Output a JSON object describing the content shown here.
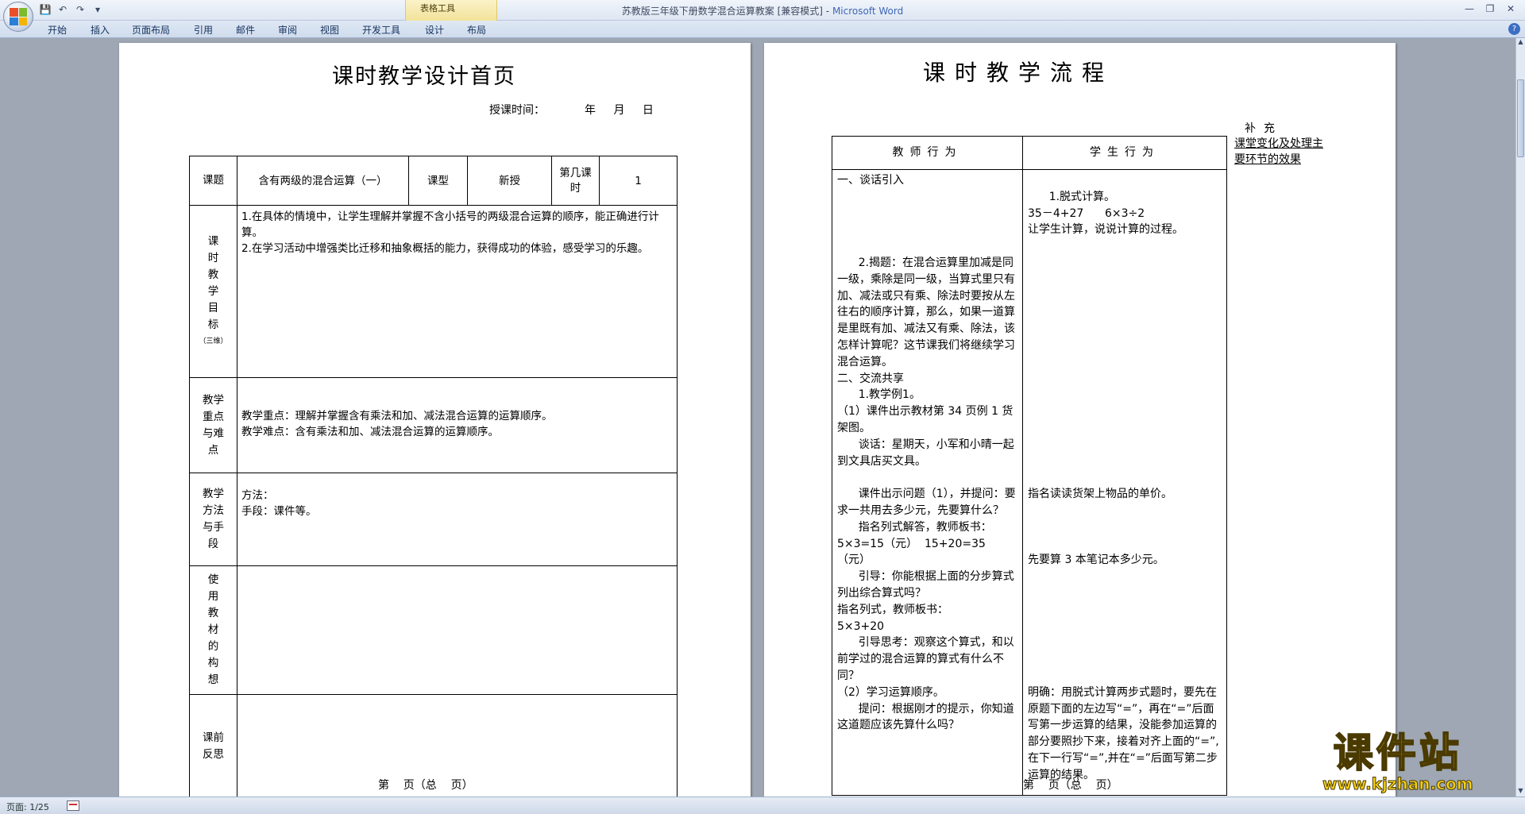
{
  "window": {
    "title": "苏教版三年级下册数学混合运算教案 [兼容模式]",
    "app": "Microsoft Word",
    "title_sep": " - ",
    "context_tab_group": "表格工具"
  },
  "qat": [
    "save",
    "undo",
    "redo",
    "customize"
  ],
  "tabs": [
    "开始",
    "插入",
    "页面布局",
    "引用",
    "邮件",
    "审阅",
    "视图",
    "开发工具",
    "设计",
    "布局"
  ],
  "page1": {
    "title": "课时教学设计首页",
    "time_label": "授课时间：",
    "time_fields": "年 月 日",
    "table": {
      "topic_label": "课题",
      "topic_value": "含有两级的混合运算（一）",
      "type_label": "课型",
      "type_value": "新授",
      "lesson_no_label": "第几课时",
      "lesson_no_value": "1",
      "goal_label": "课时教学目标",
      "goal_note": "（三维）",
      "goal_1": "1.在具体的情境中，让学生理解并掌握不含小括号的两级混合运算的顺序，能正确进行计算。",
      "goal_2": "2.在学习活动中增强类比迁移和抽象概括的能力，获得成功的体验，感受学习的乐趣。",
      "key_label": "教学重点与难点",
      "key_point": "教学重点：理解并掌握含有乘法和加、减法混合运算的运算顺序。",
      "difficulty": "教学难点：含有乘法和加、减法混合运算的运算顺序。",
      "method_label": "教学方法与手段",
      "method": "方法：",
      "means": "手段：课件等。",
      "material_label": "使用教材的构想",
      "reflect_label": "课前反思"
    },
    "footer": "第    页（总    页）"
  },
  "page2": {
    "title": "课时教学流程",
    "supp_title": "补充",
    "supp_link": "课堂变化及处理主要环节的效果",
    "col_teacher": "教师行为",
    "col_student": "学生行为",
    "teacher_text": "一、谈话引入\n\n\n\n\n      2.揭题：在混合运算里加减是同一级，乘除是同一级，当算式里只有加、减法或只有乘、除法时要按从左往右的顺序计算，那么，如果一道算是里既有加、减法又有乘、除法，该怎样计算呢？这节课我们将继续学习混合运算。\n二、交流共享\n      1.教学例1。\n（1）课件出示教材第 34 页例 1 货架图。\n      谈话：星期天，小军和小晴一起到文具店买文具。\n\n      课件出示问题（1），并提问：要求一共用去多少元，先要算什么？\n      指名列式解答，教师板书：\n5×3=15（元）  15+20=35（元）\n      引导：你能根据上面的分步算式列出综合算式吗？\n指名列式，教师板书：\n5×3+20\n      引导思考：观察这个算式，和以前学过的混合运算的算式有什么不同？\n（2）学习运算顺序。\n      提问：根据刚才的提示，你知道这道题应该先算什么吗？",
    "student_text": "\n      1.脱式计算。\n35－4+27      6×3÷2\n让学生计算，说说计算的过程。\n\n\n\n\n\n\n\n\n\n\n\n\n\n\n\n指名读读货架上物品的单价。\n\n\n\n先要算 3 本笔记本多少元。\n\n\n\n\n\n\n\n明确：用脱式计算两步式题时，要先在原题下面的左边写“=”，再在“=”后面写第一步运算的结果，没能参加运算的部分要照抄下来，接着对齐上面的“=”,在下一行写“=”,并在“=”后面写第二步运算的结果。",
    "footer": "第    页（总    页）"
  },
  "status": {
    "page": "页面: 1/25"
  },
  "watermark": {
    "main": "课件站",
    "url": "www.kjzhan.com"
  },
  "colors": {
    "ribbon_bg": "#dfe8f4",
    "context_tab": "#f2e29a",
    "doc_bg": "#9ea7b3",
    "watermark": "#f5d010"
  }
}
